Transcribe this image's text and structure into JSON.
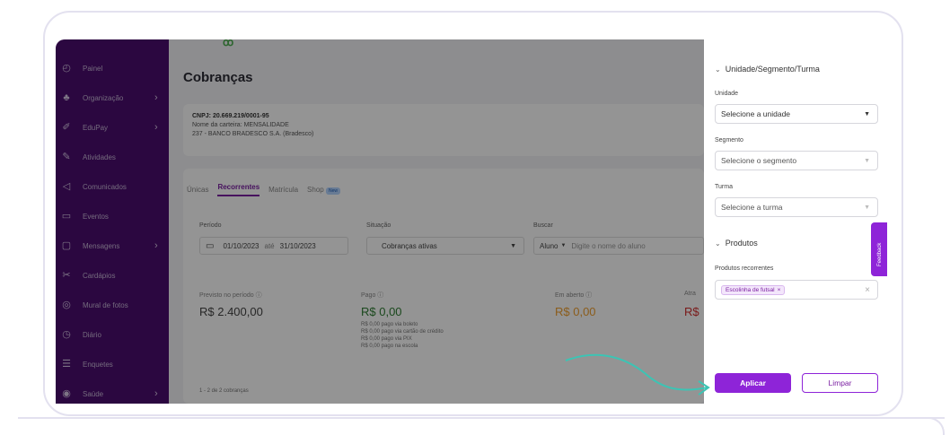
{
  "sidebar": {
    "items": [
      {
        "label": "Painel",
        "icon": "dashboard-icon",
        "glyph": "◴",
        "chevron": false
      },
      {
        "label": "Organização",
        "icon": "organization-icon",
        "glyph": "♣",
        "chevron": true
      },
      {
        "label": "EduPay",
        "icon": "edupay-icon",
        "glyph": "✐",
        "chevron": true
      },
      {
        "label": "Atividades",
        "icon": "activities-icon",
        "glyph": "✎",
        "chevron": false
      },
      {
        "label": "Comunicados",
        "icon": "announcements-icon",
        "glyph": "◁",
        "chevron": false
      },
      {
        "label": "Eventos",
        "icon": "calendar-icon",
        "glyph": "▭",
        "chevron": false
      },
      {
        "label": "Mensagens",
        "icon": "messages-icon",
        "glyph": "▢",
        "chevron": true
      },
      {
        "label": "Cardápios",
        "icon": "menu-icon",
        "glyph": "✂",
        "chevron": false
      },
      {
        "label": "Mural de fotos",
        "icon": "photos-icon",
        "glyph": "◎",
        "chevron": false
      },
      {
        "label": "Diário",
        "icon": "diary-icon",
        "glyph": "◷",
        "chevron": false
      },
      {
        "label": "Enquetes",
        "icon": "polls-icon",
        "glyph": "☰",
        "chevron": false
      },
      {
        "label": "Saúde",
        "icon": "health-icon",
        "glyph": "◉",
        "chevron": true
      }
    ]
  },
  "main": {
    "title": "Cobranças",
    "info": {
      "cnpj": "CNPJ: 20.669.219/0001-95",
      "wallet": "Nome da carteira: MENSALIDADE",
      "bank": "237 - BANCO BRADESCO S.A. (Bradesco)"
    },
    "tabs": [
      "Únicas",
      "Recorrentes",
      "Matrícula",
      "Shop"
    ],
    "tab_badge": "New",
    "filters": {
      "period_label": "Período",
      "date_from": "01/10/2023",
      "date_sep": "até",
      "date_to": "31/10/2023",
      "status_label": "Situação",
      "status_value": "Cobranças ativas",
      "search_label": "Buscar",
      "search_type": "Aluno",
      "search_placeholder": "Digite o nome do aluno"
    },
    "stats": {
      "expected_label": "Previsto no período",
      "expected_value": "R$ 2.400,00",
      "paid_label": "Pago",
      "paid_value": "R$ 0,00",
      "paid_details": [
        "R$ 0,00 pago via boleto",
        "R$ 0,00 pago via cartão de crédito",
        "R$ 0,00 pago via PIX",
        "R$ 0,00 pago na escola"
      ],
      "open_label": "Em aberto",
      "open_value": "R$ 0,00",
      "late_label": "Atra",
      "late_value": "R$"
    },
    "pagination": "1 - 2 de 2 cobranças"
  },
  "panel": {
    "section1": "Unidade/Segmento/Turma",
    "unit_label": "Unidade",
    "unit_value": "Selecione a unidade",
    "segment_label": "Segmento",
    "segment_value": "Selecione o segmento",
    "class_label": "Turma",
    "class_value": "Selecione a turma",
    "section2": "Produtos",
    "products_label": "Produtos recorrentes",
    "product_chip": "Escolinha de futsal",
    "apply_label": "Aplicar",
    "clear_label": "Limpar",
    "feedback_label": "Feedback"
  },
  "colors": {
    "sidebar": "#4a0d6e",
    "accent": "#8e24d8",
    "paid": "#2e7d32",
    "open": "#f0a030",
    "late": "#d32f2f"
  }
}
